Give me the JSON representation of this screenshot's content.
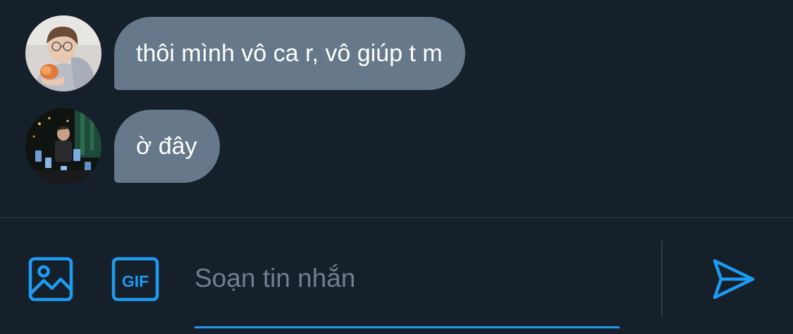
{
  "messages": [
    {
      "text": "thôi mình vô ca r, vô giúp t m",
      "avatar": "user-avatar-1"
    },
    {
      "text": "ờ đây",
      "avatar": "user-avatar-2"
    }
  ],
  "composer": {
    "placeholder": "Soạn tin nhắn",
    "value": "",
    "gif_label": "GIF",
    "icons": [
      "image-icon",
      "gif-icon",
      "send-icon"
    ]
  },
  "colors": {
    "background": "#16202b",
    "bubble": "#667889",
    "accent": "#1d9bf0",
    "placeholder": "#6f7f8f",
    "divider": "#2e3a46"
  }
}
